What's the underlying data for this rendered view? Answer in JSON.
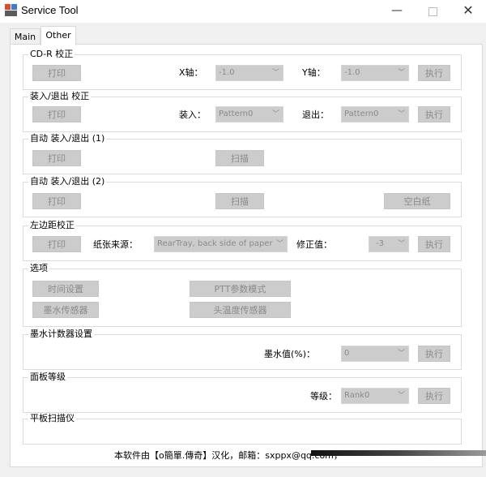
{
  "window": {
    "title": "Service Tool"
  },
  "tabs": [
    {
      "label": "Main"
    },
    {
      "label": "Other"
    }
  ],
  "groups": {
    "cdr": {
      "title": "CD-R 校正",
      "print": "打印",
      "x_label": "X轴：",
      "x_value": "-1.0",
      "y_label": "Y轴：",
      "y_value": "-1.0",
      "execute": "执行"
    },
    "loadeject": {
      "title": "装入/退出 校正",
      "print": "打印",
      "load_label": "装入：",
      "load_value": "Pattern0",
      "eject_label": "退出：",
      "eject_value": "Pattern0",
      "execute": "执行"
    },
    "auto1": {
      "title": "自动 装入/退出 (1)",
      "print": "打印",
      "scan": "扫描"
    },
    "auto2": {
      "title": "自动 装入/退出 (2)",
      "print": "打印",
      "scan": "扫描",
      "blank": "空白纸"
    },
    "leftmargin": {
      "title": "左边距校正",
      "print": "打印",
      "source_label": "纸张来源：",
      "source_value": "RearTray, back side of paper",
      "correction_label": "修正值：",
      "correction_value": "-3",
      "execute": "执行"
    },
    "options": {
      "title": "选项",
      "time_settings": "时间设置",
      "ptt_mode": "PTT参数模式",
      "ink_sensor": "墨水传感器",
      "head_temp_sensor": "头温度传感器"
    },
    "inkcounter": {
      "title": "墨水计数器设置",
      "value_label": "墨水值(%)：",
      "value": "0",
      "execute": "执行"
    },
    "panellevel": {
      "title": "面板等级",
      "level_label": "等级：",
      "level_value": "Rank0",
      "execute": "执行"
    },
    "flatbed": {
      "title": "平板扫描仪"
    }
  },
  "footer": {
    "text": "本软件由【o簡單.傳奇】汉化，邮箱：sxppx@qq.com，"
  },
  "icons": {
    "app": "app-icon",
    "minimize": "minimize-icon",
    "maximize": "maximize-icon",
    "close": "close-icon",
    "dropdown": "chevron-down-icon"
  }
}
